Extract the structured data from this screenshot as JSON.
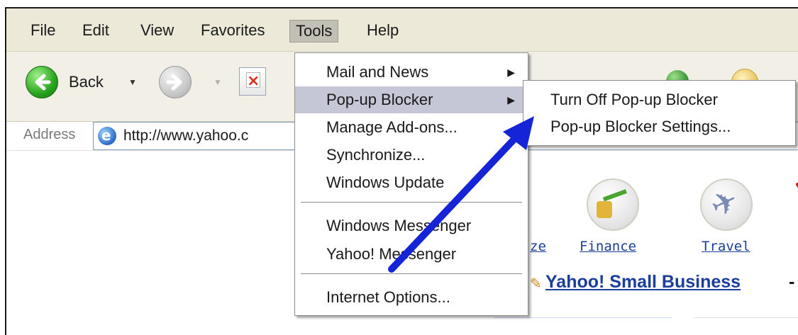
{
  "menubar": {
    "items": [
      {
        "label": "File"
      },
      {
        "label": "Edit"
      },
      {
        "label": "View"
      },
      {
        "label": "Favorites"
      },
      {
        "label": "Tools"
      },
      {
        "label": "Help"
      }
    ],
    "active": "Tools"
  },
  "toolbar": {
    "back_label": "Back"
  },
  "address": {
    "label": "Address",
    "url": "http://www.yahoo.c"
  },
  "tools_menu": {
    "items": [
      {
        "label": "Mail and News",
        "submenu": true
      },
      {
        "label": "Pop-up Blocker",
        "submenu": true,
        "highlighted": true
      },
      {
        "label": "Manage Add-ons..."
      },
      {
        "label": "Synchronize..."
      },
      {
        "label": "Windows Update"
      },
      {
        "label": "Windows Messenger"
      },
      {
        "label": "Yahoo! Messenger"
      },
      {
        "label": "Internet Options..."
      }
    ]
  },
  "popup_submenu": {
    "items": [
      {
        "label": "Turn Off Pop-up Blocker"
      },
      {
        "label": "Pop-up Blocker Settings..."
      }
    ]
  },
  "content": {
    "cut_link": "ze",
    "finance_label": "Finance",
    "travel_label": "Travel",
    "small_business": "Yahoo! Small Business",
    "dash": "-"
  },
  "colors": {
    "highlight": "#c5c6d6",
    "link": "#1a3e9a",
    "arrow": "#1424d6"
  },
  "icons": [
    "back-arrow-icon",
    "forward-arrow-icon",
    "stop-icon",
    "ie-page-icon",
    "submenu-arrow-icon",
    "finance-icon",
    "travel-icon"
  ]
}
